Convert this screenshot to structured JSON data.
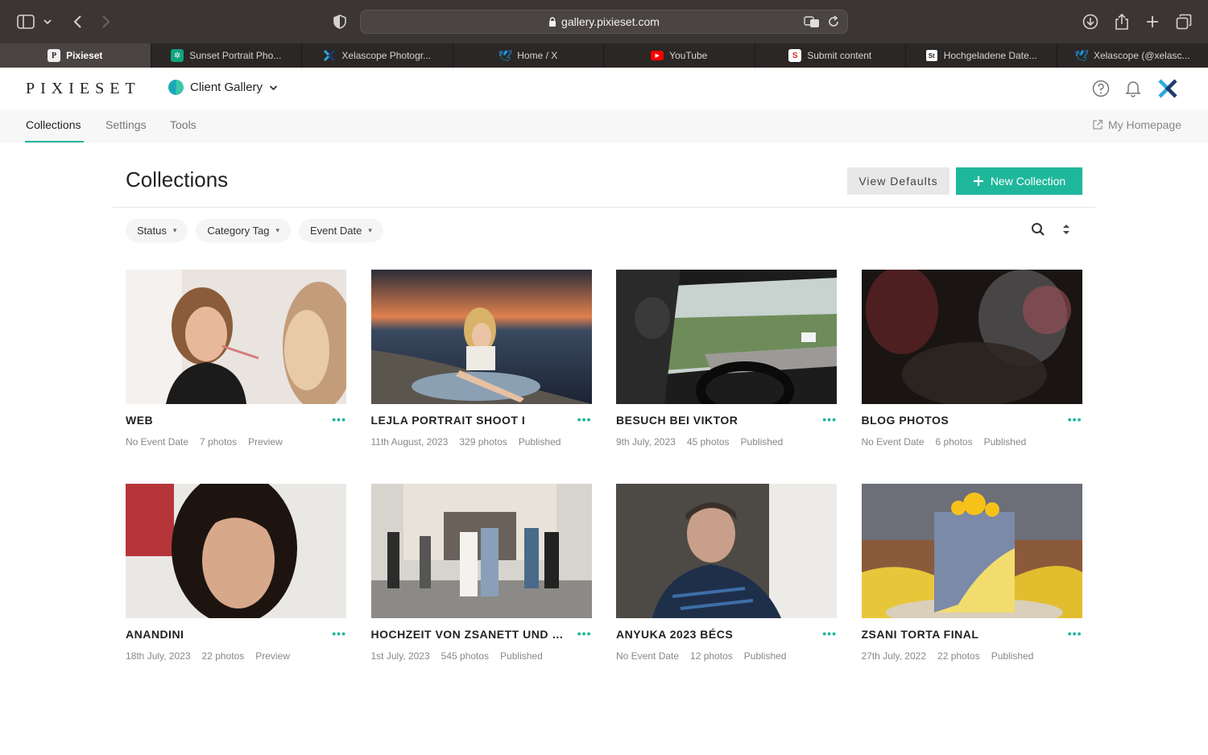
{
  "browser": {
    "url": "gallery.pixieset.com",
    "tabs": [
      {
        "label": "Pixieset",
        "icon": "pixieset-favicon",
        "active": true
      },
      {
        "label": "Sunset Portrait Pho...",
        "icon": "chatgpt-favicon"
      },
      {
        "label": "Xelascope Photogr...",
        "icon": "xelascope-favicon"
      },
      {
        "label": "Home / X",
        "icon": "twitter-favicon"
      },
      {
        "label": "YouTube",
        "icon": "youtube-favicon"
      },
      {
        "label": "Submit content",
        "icon": "submit-favicon"
      },
      {
        "label": "Hochgeladene Date...",
        "icon": "st-favicon"
      },
      {
        "label": "Xelascope (@xelasc...",
        "icon": "twitter-favicon"
      }
    ]
  },
  "app": {
    "logo": "PIXIESET",
    "gallery_switch": "Client Gallery",
    "subnav": {
      "collections": "Collections",
      "settings": "Settings",
      "tools": "Tools",
      "my_homepage": "My Homepage"
    }
  },
  "page": {
    "title": "Collections",
    "view_defaults": "View Defaults",
    "new_collection": "New Collection",
    "filters": [
      "Status",
      "Category Tag",
      "Event Date"
    ]
  },
  "collections": [
    {
      "title": "WEB",
      "date": "No Event Date",
      "photos": "7 photos",
      "status": "Preview"
    },
    {
      "title": "LEJLA PORTRAIT SHOOT I",
      "date": "11th August, 2023",
      "photos": "329 photos",
      "status": "Published"
    },
    {
      "title": "BESUCH BEI VIKTOR",
      "date": "9th July, 2023",
      "photos": "45 photos",
      "status": "Published"
    },
    {
      "title": "BLOG PHOTOS",
      "date": "No Event Date",
      "photos": "6 photos",
      "status": "Published"
    },
    {
      "title": "ANANDINI",
      "date": "18th July, 2023",
      "photos": "22 photos",
      "status": "Preview"
    },
    {
      "title": "HOCHZEIT VON ZSANETT UND P...",
      "date": "1st July, 2023",
      "photos": "545 photos",
      "status": "Published"
    },
    {
      "title": "ANYUKA 2023 BÉCS",
      "date": "No Event Date",
      "photos": "12 photos",
      "status": "Published"
    },
    {
      "title": "ZSANI TORTA FINAL",
      "date": "27th July, 2022",
      "photos": "22 photos",
      "status": "Published"
    }
  ],
  "colors": {
    "accent": "#1fb79c",
    "toolbar": "#3b3634",
    "tabstrip": "#2b2725"
  }
}
